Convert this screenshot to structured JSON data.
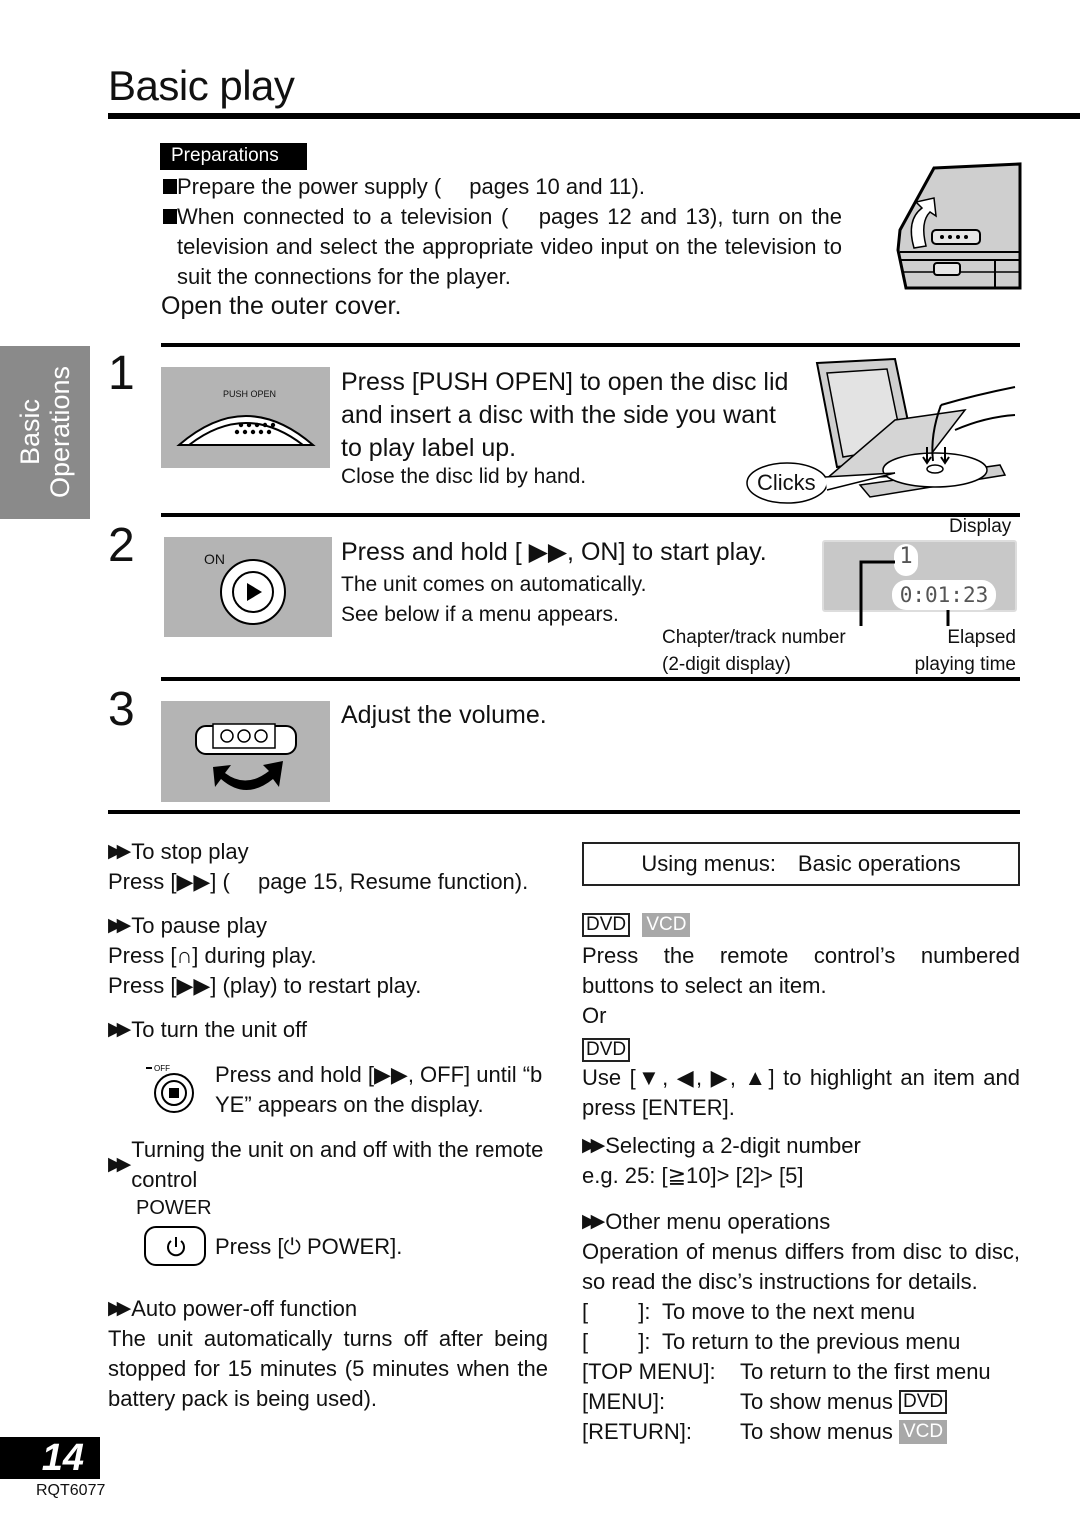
{
  "page": {
    "title": "Basic play",
    "side_tab": [
      "Basic",
      "Operations"
    ],
    "page_number": "14",
    "doc_code": "RQT6077"
  },
  "preparations": {
    "badge": "Preparations",
    "items": [
      "Prepare the power supply (  pages 10 and 11).",
      "When connected to a television (  pages 12 and 13), turn on the television and select the appropriate video input on the television to suit the connections for the player."
    ],
    "open_cover": "Open the outer cover."
  },
  "steps": [
    {
      "number": "1",
      "button_label": "PUSH OPEN",
      "main": "Press [PUSH OPEN] to open the disc lid and insert a disc with the side you want to play label up.",
      "sub": "Close the disc lid by hand.",
      "callout": "Clicks"
    },
    {
      "number": "2",
      "button_label": "ON",
      "main": "Press and hold [ ▶▶, ON] to start play.",
      "sub": [
        "The unit comes on automatically.",
        "See below if a menu appears."
      ],
      "display": {
        "label": "Display",
        "chapter": "1",
        "time": "0:01:23",
        "chapter_label": [
          "Chapter/track number",
          "(2-digit display)"
        ],
        "time_label": [
          "Elapsed",
          "playing time"
        ]
      }
    },
    {
      "number": "3",
      "main": "Adjust the volume."
    }
  ],
  "left_column": {
    "stop": {
      "heading": "To stop play",
      "text": "Press [▶▶] (  page 15, Resume function)."
    },
    "pause": {
      "heading": "To pause play",
      "lines": [
        "Press [∩] during play.",
        "Press [▶▶] (play) to restart play."
      ]
    },
    "off": {
      "heading": "To turn the unit off",
      "button_label": "OFF",
      "text": "Press and hold [▶▶, OFF] until “b YE” appears on the display."
    },
    "remote": {
      "heading": "Turning the unit on and off with the remote control",
      "power_label": "POWER",
      "text": "Press [⏻ POWER]."
    },
    "auto_off": {
      "heading": "Auto power-off function",
      "text": "The unit automatically turns off after being stopped for 15 minutes (5 minutes when the battery pack is being used)."
    }
  },
  "right_column": {
    "box_title": "Using menus: Basic operations",
    "tags": {
      "dvd": "DVD",
      "vcd": "VCD"
    },
    "numbered": "Press the remote control’s numbered buttons to select an item.",
    "or": "Or",
    "use_cursor": "Use [▼, ◀, ▶, ▲] to highlight an item and press [ENTER].",
    "two_digit": {
      "heading": "Selecting a 2-digit number",
      "text": "e.g. 25:  [≧10]>  [2]>  [5]"
    },
    "other": {
      "heading": "Other menu operations",
      "text": "Operation of menus differs from disc to disc, so read the disc’s instructions for details.",
      "rows": [
        {
          "key": "[   ]:",
          "value": "To move to the next menu"
        },
        {
          "key": "[   ]:",
          "value": "To return to the previous menu"
        },
        {
          "key": "[TOP MENU]:",
          "value": "To return to the first menu"
        },
        {
          "key": "[MENU]:",
          "value": "To show menus",
          "tag": "DVD"
        },
        {
          "key": "[RETURN]:",
          "value": "To show menus",
          "tag": "VCD"
        }
      ]
    }
  }
}
